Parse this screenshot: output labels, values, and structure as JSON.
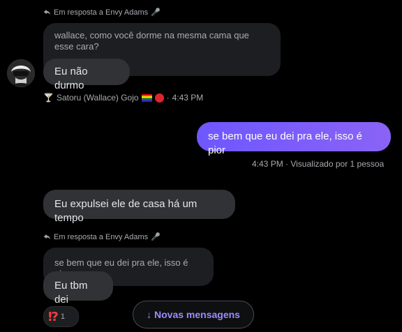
{
  "messages": [
    {
      "reply_to": "Em resposta a Envy Adams",
      "reply_emoji": "🎤",
      "quoted": "wallace, como você dorme na mesma cama que esse cara?",
      "text": "Eu não durmo",
      "sender": "Satoru (Wallace) Gojo",
      "sender_prefix_emoji": "🍸",
      "time": "4:43 PM"
    },
    {
      "text": "se bem que eu dei pra ele, isso é pior",
      "status": "4:43 PM · Visualizado por 1 pessoa"
    },
    {
      "text": "Eu expulsei ele de casa há um tempo"
    },
    {
      "reply_to": "Em resposta a Envy Adams",
      "reply_emoji": "🎤",
      "quoted": "se bem que eu dei pra ele, isso é pior",
      "text": "Eu tbm dei",
      "reaction": {
        "glyph": "⁉",
        "count": "1"
      }
    }
  ],
  "new_messages_button": {
    "arrow": "↓",
    "label": "Novas mensagens"
  },
  "colors": {
    "background": "#000000",
    "incoming_bubble": "#303236",
    "quoted_bubble": "#1c1e21",
    "outgoing_bubble": "#7b5cff",
    "accent_text": "#9b8cff"
  }
}
